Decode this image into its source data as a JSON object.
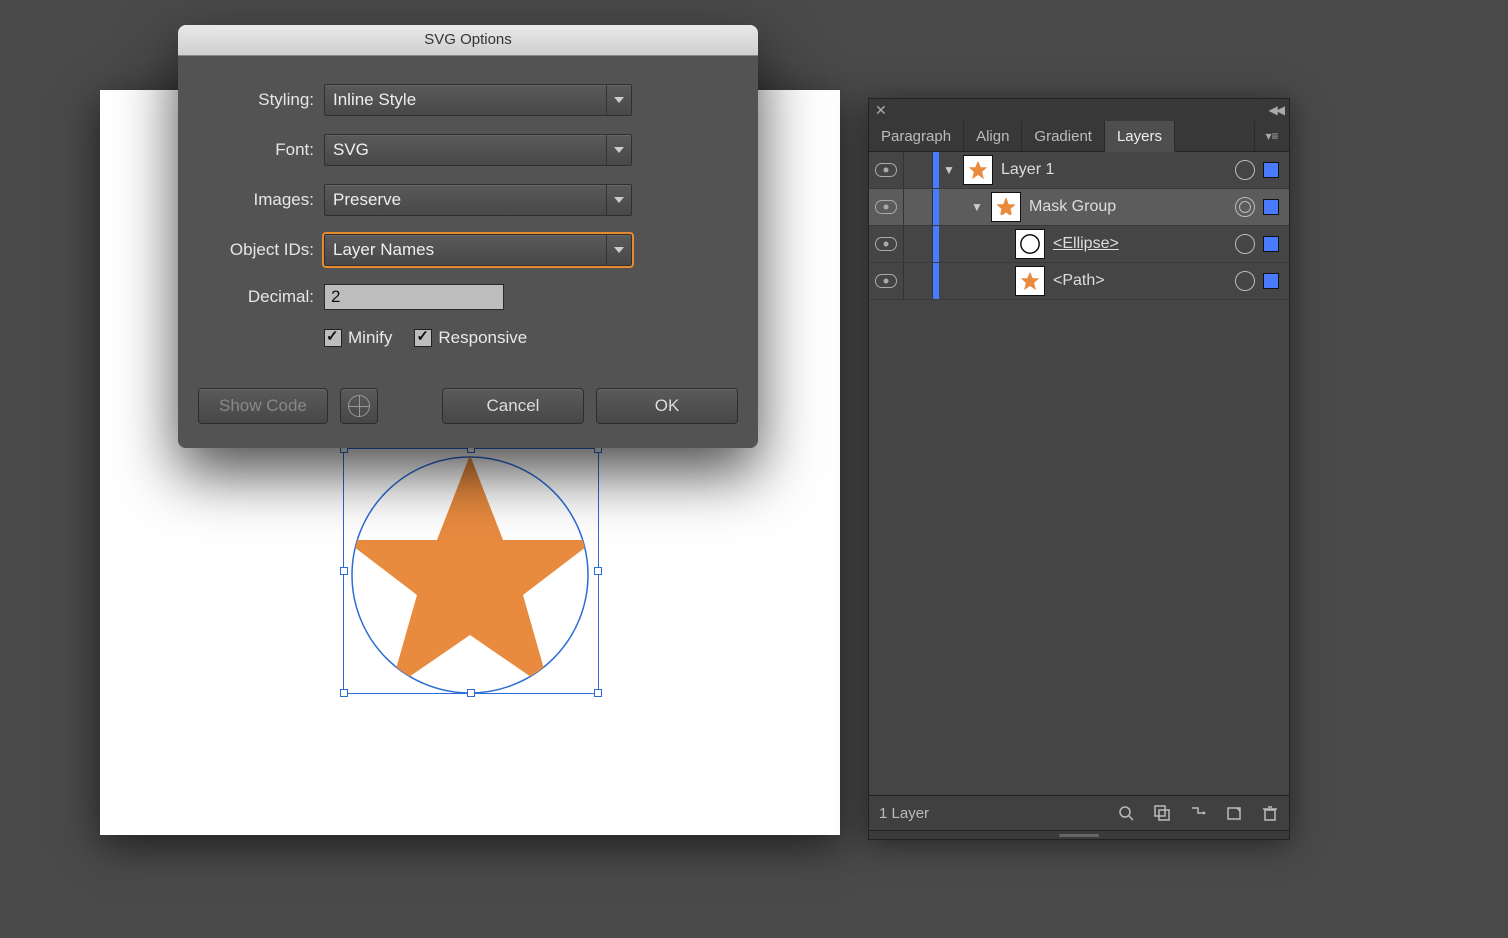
{
  "dialog": {
    "title": "SVG Options",
    "styling_label": "Styling:",
    "styling_value": "Inline Style",
    "font_label": "Font:",
    "font_value": "SVG",
    "images_label": "Images:",
    "images_value": "Preserve",
    "objectids_label": "Object IDs:",
    "objectids_value": "Layer Names",
    "decimal_label": "Decimal:",
    "decimal_value": "2",
    "minify_label": "Minify",
    "responsive_label": "Responsive",
    "show_code_label": "Show Code",
    "cancel_label": "Cancel",
    "ok_label": "OK"
  },
  "panel": {
    "tabs": {
      "paragraph": "Paragraph",
      "align": "Align",
      "gradient": "Gradient",
      "layers": "Layers"
    },
    "rows": {
      "layer1": "Layer 1",
      "maskgroup": "Mask Group",
      "ellipse": "<Ellipse>",
      "path": "<Path>"
    },
    "footer_label": "1 Layer"
  },
  "colors": {
    "orange": "#e88b3f",
    "layer_blue": "#4a7bff"
  }
}
